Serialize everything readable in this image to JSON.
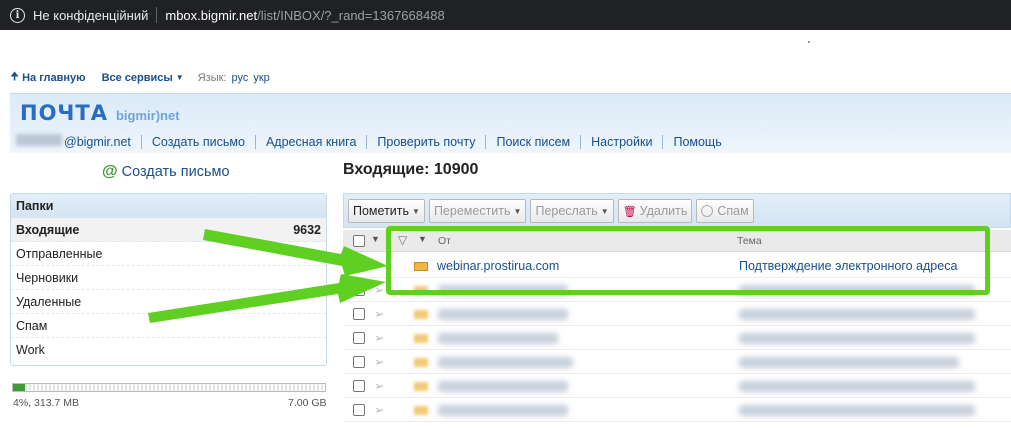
{
  "browser": {
    "security_label": "Не конфіденційний",
    "host": "mbox.bigmir.net",
    "path": "/list/INBOX/?_rand=1367668488"
  },
  "topnav": {
    "home": "На главную",
    "services": "Все сервисы",
    "lang_label": "Язык:",
    "lang_ru": "рус",
    "lang_ua": "укр"
  },
  "header": {
    "logo_main": "ПОЧТА",
    "logo_sub": "bigmir)net",
    "user_email_suffix": "@bigmir.net",
    "menu": [
      "Создать письмо",
      "Адресная книга",
      "Проверить почту",
      "Поиск писем",
      "Настройки",
      "Помощь"
    ]
  },
  "sidebar": {
    "compose": "Создать письмо",
    "folders_title": "Папки",
    "folders": [
      {
        "name": "Входящие",
        "count": "9632"
      },
      {
        "name": "Отправленные",
        "count": ""
      },
      {
        "name": "Черновики",
        "count": ""
      },
      {
        "name": "Удаленные",
        "count": ""
      },
      {
        "name": "Спам",
        "count": ""
      },
      {
        "name": "Work",
        "count": ""
      }
    ],
    "storage": {
      "percent": 4,
      "used": "4%, 313.7 MB",
      "total": "7.00 GB"
    }
  },
  "main": {
    "title": "Входящие: 10900",
    "toolbar": {
      "mark": "Пометить",
      "move": "Переместить",
      "forward": "Переслать",
      "delete": "Удалить",
      "spam": "Спам"
    },
    "columns": {
      "from": "От",
      "subject": "Тема"
    },
    "messages": [
      {
        "from": "webinar.prostirua.com",
        "subject": "Подтверждение электронного адреса"
      }
    ]
  },
  "colors": {
    "accent": "#1a4f8b",
    "highlight": "#5fd022",
    "storage_fill": "#3f9a34"
  }
}
